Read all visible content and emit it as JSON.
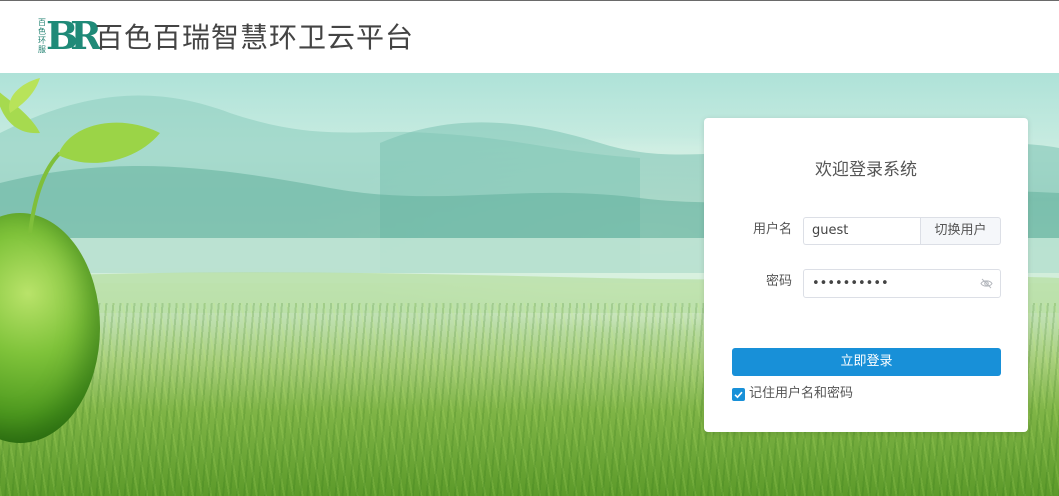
{
  "header": {
    "logo_small_text": "百色环服",
    "logo_letters": "BR",
    "title": "百色百瑞智慧环卫云平台"
  },
  "login": {
    "title": "欢迎登录系统",
    "username_label": "用户名",
    "username_value": "guest",
    "switch_user_label": "切换用户",
    "password_label": "密码",
    "password_value": "••••••••••",
    "password_toggle_icon": "eye-off-icon",
    "submit_label": "立即登录",
    "remember": {
      "label": "记住用户名和密码",
      "checked": true
    }
  },
  "colors": {
    "brand": "#1f8a78",
    "primary": "#1890d8"
  }
}
